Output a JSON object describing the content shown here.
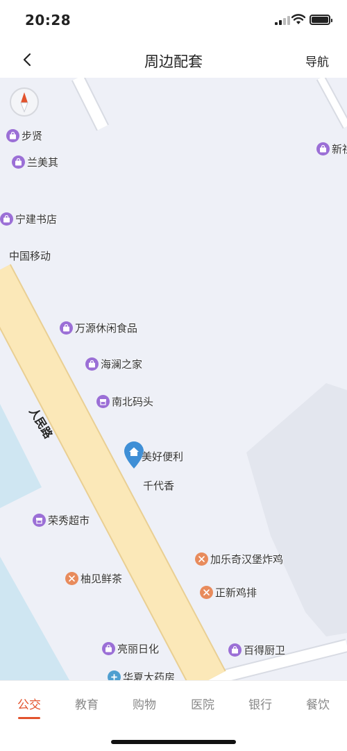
{
  "status_bar": {
    "time": "20:28"
  },
  "header": {
    "title": "周边配套",
    "nav_label": "导航",
    "back_icon": "chevron-left-icon"
  },
  "map": {
    "road_label": "人民路",
    "pois": [
      {
        "name": "步贤",
        "icon": "shopping-bag-icon",
        "color": "#9b6fd6"
      },
      {
        "name": "兰美其",
        "icon": "shopping-bag-icon",
        "color": "#9b6fd6"
      },
      {
        "name": "新社",
        "icon": "shopping-bag-icon",
        "color": "#9b6fd6"
      },
      {
        "name": "宁建书店",
        "icon": "shopping-bag-icon",
        "color": "#9b6fd6"
      },
      {
        "name": "中国移动",
        "icon": "",
        "color": ""
      },
      {
        "name": "万源休闲食品",
        "icon": "shopping-bag-icon",
        "color": "#9b6fd6"
      },
      {
        "name": "海澜之家",
        "icon": "shopping-bag-icon",
        "color": "#9b6fd6"
      },
      {
        "name": "南北码头",
        "icon": "store-icon",
        "color": "#9b6fd6"
      },
      {
        "name": "美好便利",
        "icon": "home-pin-icon",
        "color": "#3f8fd6"
      },
      {
        "name": "千代香",
        "icon": "",
        "color": ""
      },
      {
        "name": "荣秀超市",
        "icon": "store-icon",
        "color": "#9b6fd6"
      },
      {
        "name": "加乐奇汉堡炸鸡",
        "icon": "fork-knife-icon",
        "color": "#e88b5c"
      },
      {
        "name": "柚见鲜茶",
        "icon": "fork-knife-icon",
        "color": "#e88b5c"
      },
      {
        "name": "正新鸡排",
        "icon": "fork-knife-icon",
        "color": "#e88b5c"
      },
      {
        "name": "亮丽日化",
        "icon": "shopping-bag-icon",
        "color": "#9b6fd6"
      },
      {
        "name": "百得厨卫",
        "icon": "shopping-bag-icon",
        "color": "#9b6fd6"
      },
      {
        "name": "华夏大药房",
        "icon": "pharmacy-icon",
        "color": "#4f9fd0"
      }
    ]
  },
  "tabs": [
    {
      "label": "公交",
      "active": true
    },
    {
      "label": "教育",
      "active": false
    },
    {
      "label": "购物",
      "active": false
    },
    {
      "label": "医院",
      "active": false
    },
    {
      "label": "银行",
      "active": false
    },
    {
      "label": "餐饮",
      "active": false
    }
  ],
  "colors": {
    "accent": "#e2532d",
    "map_bg": "#eef0f7",
    "road": "#fbe8b8",
    "water": "#cfe6f2"
  }
}
